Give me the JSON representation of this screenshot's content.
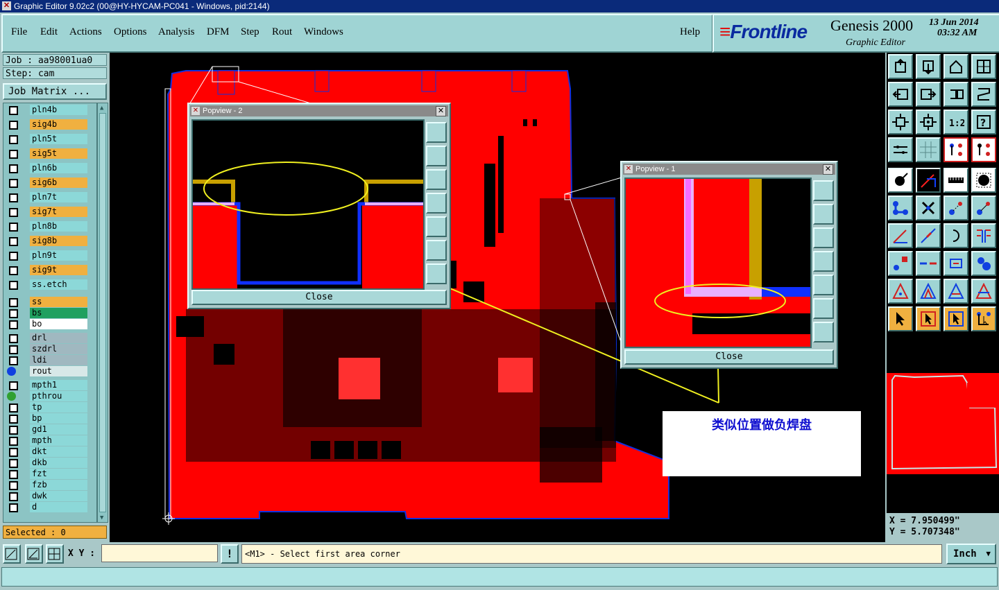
{
  "window": {
    "title": "Graphic Editor 9.02c2 (00@HY-HYCAM-PC041 - Windows, pid:2144)"
  },
  "menu": {
    "items": [
      "File",
      "Edit",
      "Actions",
      "Options",
      "Analysis",
      "DFM",
      "Step",
      "Rout",
      "Windows"
    ],
    "help": "Help"
  },
  "brand": {
    "logo": "Frontline",
    "product": "Genesis 2000",
    "subtitle": "Graphic Editor",
    "date": "13 Jun 2014",
    "time": "03:32 AM"
  },
  "job": {
    "job_line": "Job : aa98001ua0",
    "step_line": "Step: cam",
    "matrix_button": "Job Matrix ..."
  },
  "layers": [
    {
      "name": "pln4b",
      "color": "#8cd8d8",
      "kind": "cb"
    },
    {
      "name": "sig4b",
      "color": "#f0b040",
      "kind": "cb"
    },
    {
      "name": "pln5t",
      "color": "#8cd8d8",
      "kind": "cb"
    },
    {
      "name": "sig5t",
      "color": "#f0b040",
      "kind": "cb"
    },
    {
      "name": "pln6b",
      "color": "#8cd8d8",
      "kind": "cb"
    },
    {
      "name": "sig6b",
      "color": "#f0b040",
      "kind": "cb"
    },
    {
      "name": "pln7t",
      "color": "#8cd8d8",
      "kind": "cb"
    },
    {
      "name": "sig7t",
      "color": "#f0b040",
      "kind": "cb"
    },
    {
      "name": "pln8b",
      "color": "#8cd8d8",
      "kind": "cb"
    },
    {
      "name": "sig8b",
      "color": "#f0b040",
      "kind": "cb"
    },
    {
      "name": "pln9t",
      "color": "#8cd8d8",
      "kind": "cb"
    },
    {
      "name": "sig9t",
      "color": "#f0b040",
      "kind": "cb"
    },
    {
      "name": "ss.etch",
      "color": "#8cd8d8",
      "kind": "cb"
    },
    {
      "name": "ss",
      "color": "#f0b040",
      "kind": "cb"
    },
    {
      "name": "bs",
      "color": "#20a060",
      "kind": "cb"
    },
    {
      "name": "bo",
      "color": "#ffffff",
      "kind": "cb"
    },
    {
      "name": "drl",
      "color": "#a0b8c0",
      "kind": "cb"
    },
    {
      "name": "szdrl",
      "color": "#a0b8c0",
      "kind": "cb"
    },
    {
      "name": "ldi",
      "color": "#a0b8c0",
      "kind": "cb"
    },
    {
      "name": "rout",
      "color": "#d8e8e8",
      "kind": "dot",
      "dot": "#1040e0"
    },
    {
      "name": "mpth1",
      "color": "#8cd8d8",
      "kind": "cb"
    },
    {
      "name": "pthrou",
      "color": "#8cd8d8",
      "kind": "dot",
      "dot": "#30a030"
    },
    {
      "name": "tp",
      "color": "#8cd8d8",
      "kind": "cb"
    },
    {
      "name": "bp",
      "color": "#8cd8d8",
      "kind": "cb"
    },
    {
      "name": "gd1",
      "color": "#8cd8d8",
      "kind": "cb"
    },
    {
      "name": "mpth",
      "color": "#8cd8d8",
      "kind": "cb"
    },
    {
      "name": "dkt",
      "color": "#8cd8d8",
      "kind": "cb"
    },
    {
      "name": "dkb",
      "color": "#8cd8d8",
      "kind": "cb"
    },
    {
      "name": "fzt",
      "color": "#8cd8d8",
      "kind": "cb"
    },
    {
      "name": "fzb",
      "color": "#8cd8d8",
      "kind": "cb"
    },
    {
      "name": "dwk",
      "color": "#8cd8d8",
      "kind": "cb"
    },
    {
      "name": "d",
      "color": "#8cd8d8",
      "kind": "cb"
    }
  ],
  "selected": "Selected : 0",
  "popups": [
    {
      "title": "Popview - 2",
      "close": "Close"
    },
    {
      "title": "Popview - 1",
      "close": "Close"
    }
  ],
  "annotation": "类似位置做负焊盘",
  "coords": {
    "x": "X =  7.950499\"",
    "y": "Y =  5.707348\""
  },
  "bottom": {
    "xy_label": "X Y :",
    "xy_value": "",
    "prompt": "<M1> - Select first area corner",
    "units": "Inch"
  },
  "colors": {
    "board": "#ff0000",
    "rout": "#1030e0",
    "highlight": "#f0f020",
    "panel": "#9fd4d4"
  }
}
